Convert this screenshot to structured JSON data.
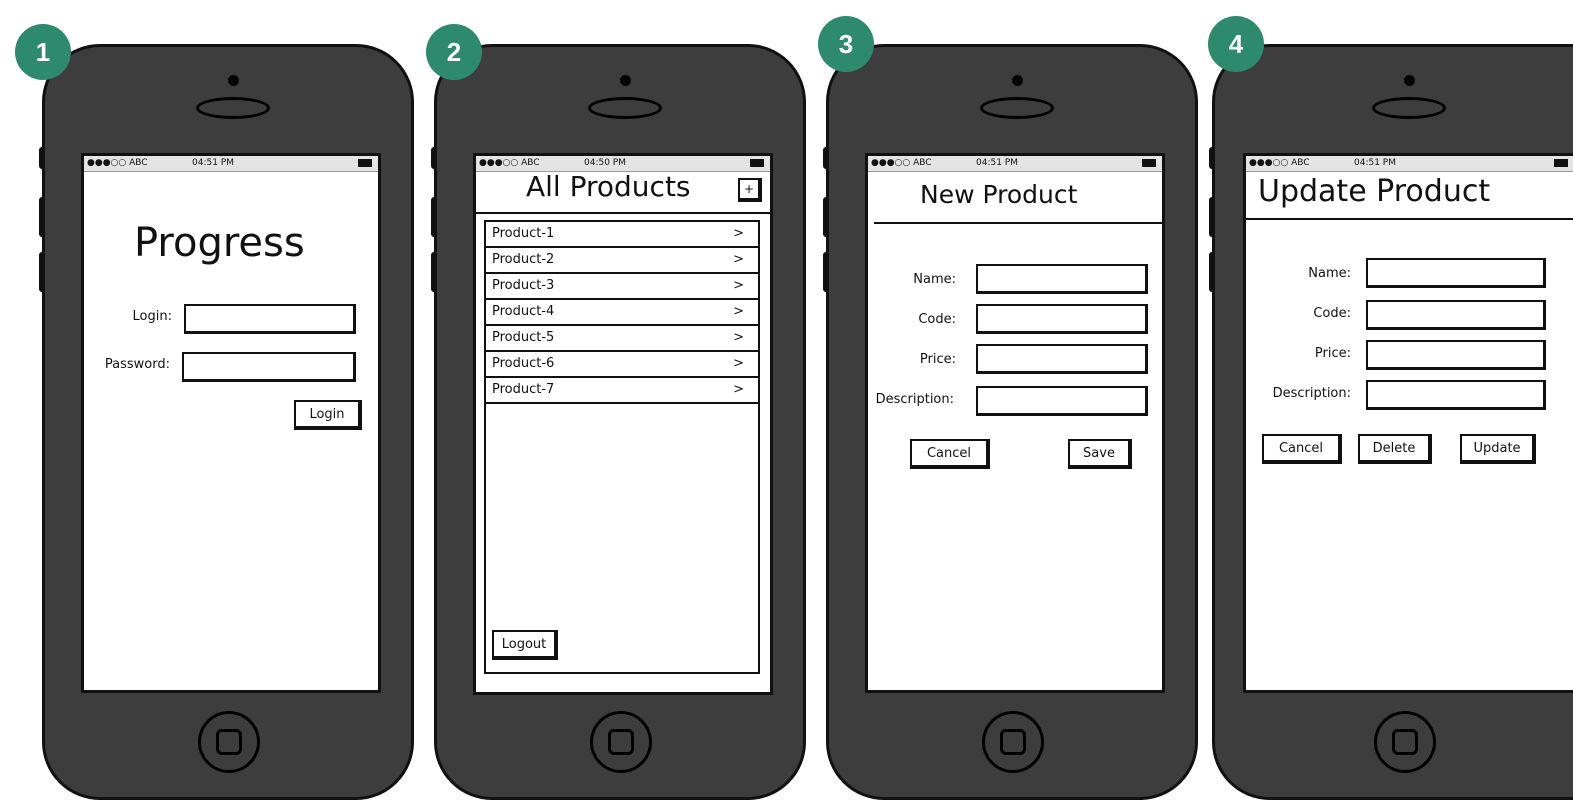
{
  "statusbar": {
    "carrier": "●●●○○ ABC",
    "time_1": "04:51 PM",
    "time_2": "04:50 PM",
    "time_3": "04:51 PM",
    "time_4": "04:51 PM"
  },
  "badges": [
    "1",
    "2",
    "3",
    "4"
  ],
  "colors": {
    "badge": "#2e8a6d",
    "phone_body": "#3d3d3d",
    "screen": "#ffffff"
  },
  "screen1": {
    "title": "Progress",
    "login_label": "Login:",
    "password_label": "Password:",
    "login_value": "",
    "password_value": "",
    "login_button": "Login"
  },
  "screen2": {
    "title": "All Products",
    "add_button": "+",
    "products": [
      {
        "name": "Product-1",
        "chevron": ">"
      },
      {
        "name": "Product-2",
        "chevron": ">"
      },
      {
        "name": "Product-3",
        "chevron": ">"
      },
      {
        "name": "Product-4",
        "chevron": ">"
      },
      {
        "name": "Product-5",
        "chevron": ">"
      },
      {
        "name": "Product-6",
        "chevron": ">"
      },
      {
        "name": "Product-7",
        "chevron": ">"
      }
    ],
    "logout_button": "Logout"
  },
  "screen3": {
    "title": "New Product",
    "name_label": "Name:",
    "code_label": "Code:",
    "price_label": "Price:",
    "description_label": "Description:",
    "cancel_button": "Cancel",
    "save_button": "Save"
  },
  "screen4": {
    "title": "Update Product",
    "name_label": "Name:",
    "code_label": "Code:",
    "price_label": "Price:",
    "description_label": "Description:",
    "cancel_button": "Cancel",
    "delete_button": "Delete",
    "update_button": "Update"
  }
}
